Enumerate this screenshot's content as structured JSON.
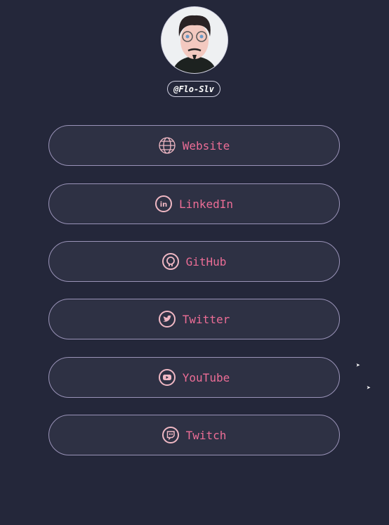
{
  "profile": {
    "handle": "@Flo-Slv"
  },
  "links": [
    {
      "label": "Website",
      "icon": "globe-icon"
    },
    {
      "label": "LinkedIn",
      "icon": "linkedin-icon"
    },
    {
      "label": "GitHub",
      "icon": "github-icon"
    },
    {
      "label": "Twitter",
      "icon": "twitter-icon"
    },
    {
      "label": "YouTube",
      "icon": "youtube-icon"
    },
    {
      "label": "Twitch",
      "icon": "twitch-icon"
    }
  ],
  "colors": {
    "background": "#24273a",
    "accent": "#ec6d96",
    "icon": "#f0b8c4"
  }
}
